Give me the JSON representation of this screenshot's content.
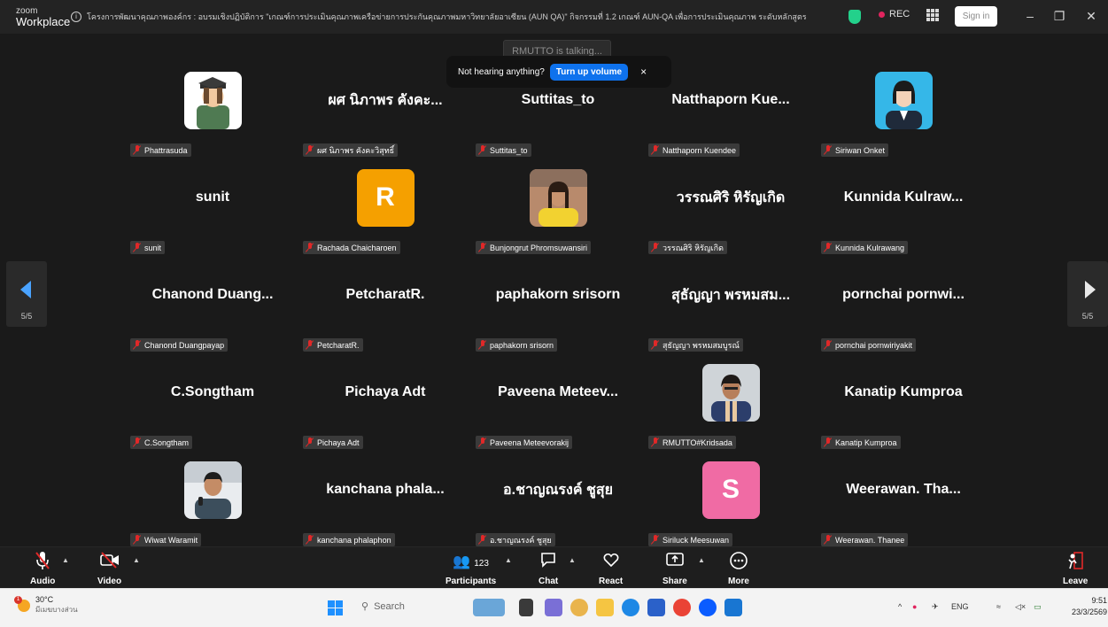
{
  "titlebar": {
    "logo_small": "zoom",
    "logo_big": "Workplace",
    "meeting_title": "โครงการพัฒนาคุณภาพองค์กร : อบรมเชิงปฏิบัติการ \"เกณฑ์การประเมินคุณภาพเครือข่ายการประกันคุณภาพมหาวิทยาลัยอาเซียน (AUN QA)\" กิจกรรมที่ 1.2 เกณฑ์ AUN-QA เพื่อการประเมินคุณภาพ ระดับหลักสูตร",
    "rec_label": "REC",
    "signin_label": "Sign in",
    "minimize": "–",
    "restore": "❐",
    "close": "✕"
  },
  "banner": {
    "talking": "RMUTTO is talking...",
    "prompt": "Not hearing anything?",
    "button": "Turn up volume",
    "close": "×"
  },
  "pager": {
    "left_page": "5/5",
    "right_page": "5/5"
  },
  "tiles": [
    {
      "label": "Phattrasuda",
      "avatar": "photo-graduate"
    },
    {
      "display": "ผศ นิภาพร คังคะ...",
      "label": "ผศ นิภาพร คังคะวิสุทธิ์"
    },
    {
      "display": "Suttitas_to",
      "label": "Suttitas_to"
    },
    {
      "display": "Natthaporn Kue...",
      "label": "Natthaporn Kuendee"
    },
    {
      "label": "Siriwan Onket",
      "avatar": "photo-woman"
    },
    {
      "display": "sunit",
      "label": "sunit"
    },
    {
      "label": "Rachada Chaicharoen",
      "avatar_letter": "R",
      "avatar_color": "#f5a000"
    },
    {
      "label": "Bunjongrut Phromsuwansiri",
      "avatar": "photo-woman-yellow"
    },
    {
      "display": "วรรณศิริ หิรัญเกิด",
      "label": "วรรณศิริ หิรัญเกิด"
    },
    {
      "display": "Kunnida Kulraw...",
      "label": "Kunnida Kulrawang"
    },
    {
      "display": "Chanond Duang...",
      "label": "Chanond Duangpayap"
    },
    {
      "display": "PetcharatR.",
      "label": "PetcharatR."
    },
    {
      "display": "paphakorn srisorn",
      "label": "paphakorn srisorn"
    },
    {
      "display": "สุธัญญา พรหมสม...",
      "label": "สุธัญญา พรหมสมบูรณ์"
    },
    {
      "display": "pornchai pornwi...",
      "label": "pornchai pornwiriyakit"
    },
    {
      "display": "C.Songtham",
      "label": "C.Songtham"
    },
    {
      "display": "Pichaya Adt",
      "label": "Pichaya Adt"
    },
    {
      "display": "Paveena Meteev...",
      "label": "Paveena Meteevorakij"
    },
    {
      "label": "RMUTTO#Kridsada",
      "avatar": "photo-man-scarf"
    },
    {
      "display": "Kanatip Kumproa",
      "label": "Kanatip Kumproa"
    },
    {
      "label": "Wiwat Waramit",
      "avatar": "photo-man-mic"
    },
    {
      "display": "kanchana phala...",
      "label": "kanchana phalaphon"
    },
    {
      "display": "อ.ชาญณรงค์ ชูสุย",
      "label": "อ.ชาญณรงค์ ชูสุย"
    },
    {
      "label": "Siriluck Meesuwan",
      "avatar_letter": "S",
      "avatar_color": "#f06ba4"
    },
    {
      "display": "Weerawan. Tha...",
      "label": "Weerawan. Thanee"
    }
  ],
  "toolbar": {
    "audio": "Audio",
    "video": "Video",
    "participants": "Participants",
    "participants_count": "123",
    "chat": "Chat",
    "react": "React",
    "share": "Share",
    "more": "More",
    "leave": "Leave"
  },
  "taskbar": {
    "temp": "30°C",
    "weather_desc": "มีเมฆบางส่วน",
    "search": "Search",
    "lang": "ENG",
    "time": "9:51",
    "date": "23/3/2569"
  },
  "colors": {
    "accent": "#0e72ed",
    "mic_off": "#e02828",
    "pager_arrow": "#4aa3ff"
  }
}
